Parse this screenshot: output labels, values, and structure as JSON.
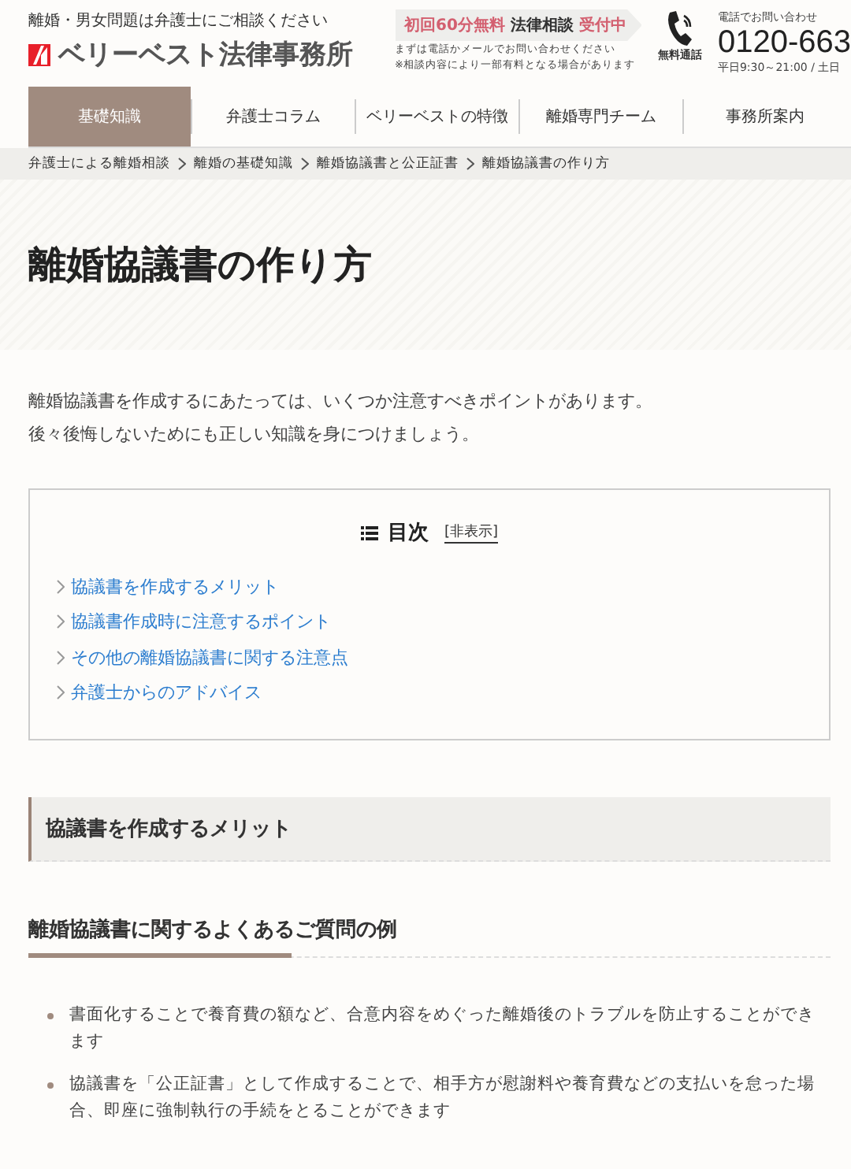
{
  "header": {
    "tagline": "離婚・男女問題は弁護士にご相談ください",
    "logo_text": "ベリーベスト法律事務所",
    "promo": {
      "free": "初回60分無料",
      "label": "法律相談",
      "status": "受付中"
    },
    "promo_notes": [
      "まずは電話かメールでお問い合わせください",
      "※相談内容により一部有料となる場合があります"
    ],
    "phone": {
      "caption": "無料通話",
      "label": "電話でお問い合わせ",
      "number": "0120-663",
      "hours": "平日9:30～21:00 / 土日"
    }
  },
  "nav": [
    {
      "label": "基礎知識",
      "selected": true
    },
    {
      "label": "弁護士コラム",
      "selected": false
    },
    {
      "label": "ベリーベストの特徴",
      "selected": false
    },
    {
      "label": "離婚専門チーム",
      "selected": false
    },
    {
      "label": "事務所案内",
      "selected": false
    }
  ],
  "breadcrumb": [
    "弁護士による離婚相談",
    "離婚の基礎知識",
    "離婚協議書と公正証書",
    "離婚協議書の作り方"
  ],
  "title": "離婚協議書の作り方",
  "intro": [
    "離婚協議書を作成するにあたっては、いくつか注意すべきポイントがあります。",
    "後々後悔しないためにも正しい知識を身につけましょう。"
  ],
  "toc": {
    "title": "目次",
    "toggle": "[非表示]",
    "items": [
      "協議書を作成するメリット",
      "協議書作成時に注意するポイント",
      "その他の離婚協議書に関する注意点",
      "弁護士からのアドバイス"
    ]
  },
  "section_heading": "協議書を作成するメリット",
  "sub_heading": "離婚協議書に関するよくあるご質問の例",
  "bullets": [
    "書面化することで養育費の額など、合意内容をめぐった離婚後のトラブルを防止することができます",
    "協議書を「公正証書」として作成することで、相手方が慰謝料や養育費などの支払いを怠った場合、即座に強制執行の手続をとることができます"
  ]
}
